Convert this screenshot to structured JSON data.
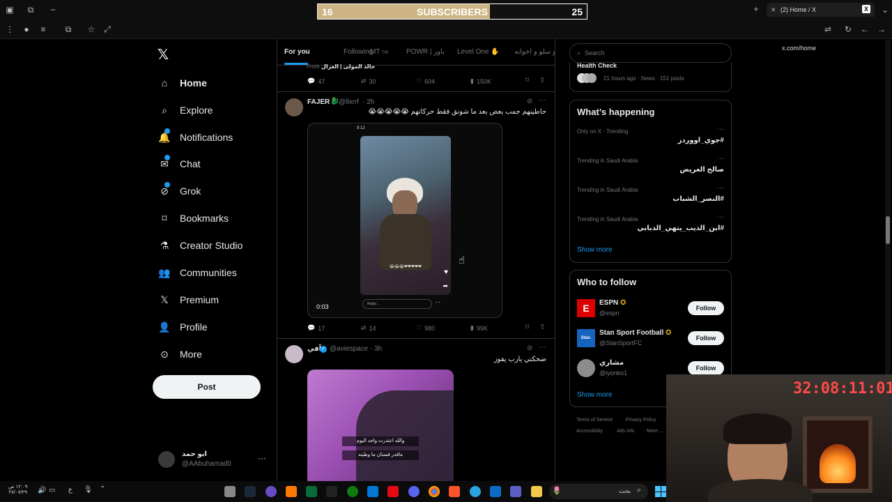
{
  "browser": {
    "tab_title": "(2) Home / X",
    "url": "x.com/home"
  },
  "subscriber_goal": {
    "current": "16",
    "label": "SUBSCRIBERS",
    "goal": "25",
    "progress": 0.64
  },
  "nav": {
    "items": [
      {
        "label": "Home",
        "icon": "home-icon"
      },
      {
        "label": "Explore",
        "icon": "search-icon"
      },
      {
        "label": "Notifications",
        "icon": "bell-icon"
      },
      {
        "label": "Chat",
        "icon": "mail-icon"
      },
      {
        "label": "Grok",
        "icon": "grok-icon"
      },
      {
        "label": "Bookmarks",
        "icon": "bookmark-icon"
      },
      {
        "label": "Creator Studio",
        "icon": "flask-icon"
      },
      {
        "label": "Communities",
        "icon": "people-icon"
      },
      {
        "label": "Premium",
        "icon": "x-icon"
      },
      {
        "label": "Profile",
        "icon": "person-icon"
      },
      {
        "label": "More",
        "icon": "more-circle-icon"
      }
    ],
    "post_label": "Post",
    "account": {
      "name": "ابو حمد",
      "handle": "@AAbuhamad0"
    }
  },
  "feed": {
    "tabs": [
      "For you",
      "Following",
      "MT",
      "POWR | باور",
      "Level One",
      "و سلو و اخوانه"
    ],
    "mt_suffix": "TM",
    "prev_tweet": {
      "from_label": "From",
      "from_name": "خالد المولى | الغزال",
      "stats": {
        "replies": "47",
        "retweets": "30",
        "likes": "604",
        "views": "150K"
      }
    },
    "tweet1": {
      "name": "FAJER",
      "handle": "@llxrrf",
      "time": "· 2h",
      "text": "حاطينهم جمب بعض بعد ما شونق فقط حركاتهم 😭😭😭😭😭",
      "video": {
        "status_time": "9:12",
        "emoji_row": "😂😂😂❤❤❤❤❤",
        "reply_placeholder": "Reply...",
        "duration": "0:03"
      },
      "stats": {
        "replies": "17",
        "retweets": "14",
        "likes": "980",
        "views": "99K"
      }
    },
    "tweet2": {
      "name": "آفي",
      "handle": "@aviespace",
      "time": "· 3h",
      "text": "ضحكني يارب يفوز",
      "image_caption1": "والله اعتذرت واجد اليوم",
      "image_caption2": "ماقدر فستان ما وطيته"
    }
  },
  "sidebar": {
    "search_placeholder": "Search",
    "health": {
      "title": "Health Check",
      "meta": "21 hours ago · News · 151 posts"
    },
    "whats_happening": {
      "title": "What’s happening",
      "trends": [
        {
          "meta": "Only on X · Trending",
          "tag": "#جوي_اووردز"
        },
        {
          "meta": "Trending in Saudi Arabia",
          "tag": "صالح العريض"
        },
        {
          "meta": "Trending in Saudi Arabia",
          "tag": "#النصر_الشباب"
        },
        {
          "meta": "Trending in Saudi Arabia",
          "tag": "#ابن_الذيب_ينهي_الدبابي"
        }
      ],
      "show_more": "Show more"
    },
    "who_to_follow": {
      "title": "Who to follow",
      "accounts": [
        {
          "name": "ESPN",
          "handle": "@espn",
          "button": "Follow"
        },
        {
          "name": "Stan Sport Football",
          "handle": "@StanSportFC",
          "button": "Follow"
        },
        {
          "name": "مشاري",
          "handle": "@iyonko1",
          "button": "Follow"
        }
      ],
      "show_more": "Show more"
    },
    "footer": [
      "Terms of Service",
      "Privacy Policy",
      "Accessibility",
      "Ads info",
      "More ..."
    ]
  },
  "overlay": {
    "timer": "32:08:11:01"
  },
  "taskbar": {
    "search_text": "بحث",
    "clock_time": "١٢:٠٩ ص",
    "clock_date": "٢٧/٠٧/٢٩",
    "lang": "ع"
  }
}
